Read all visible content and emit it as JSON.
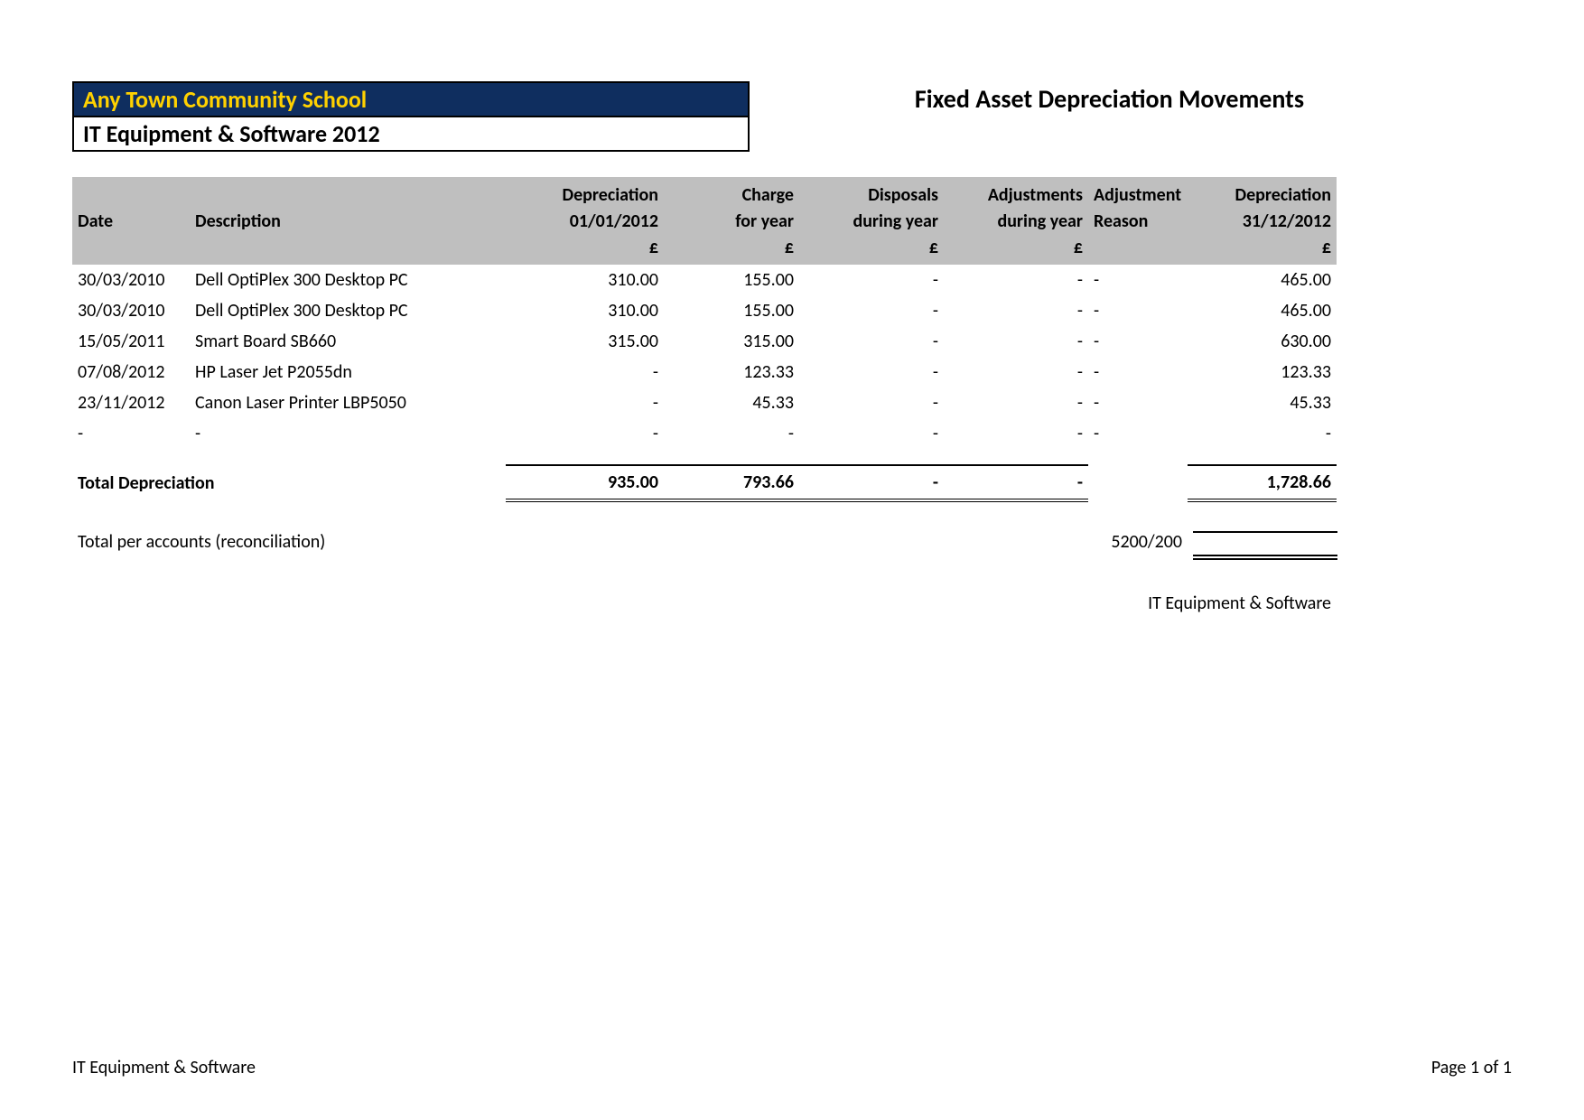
{
  "header": {
    "school_name": "Any Town Community School",
    "category_title": "IT Equipment & Software 2012",
    "report_title": "Fixed Asset Depreciation Movements"
  },
  "columns": {
    "date": "Date",
    "description": "Description",
    "open_l1": "Depreciation",
    "open_l2": "01/01/2012",
    "charge_l1": "Charge",
    "charge_l2": "for year",
    "disposals_l1": "Disposals",
    "disposals_l2": "during year",
    "adjustments_l1": "Adjustments",
    "adjustments_l2": "during year",
    "reason_l1": "Adjustment",
    "reason_l2": "Reason",
    "close_l1": "Depreciation",
    "close_l2": "31/12/2012",
    "currency": "£"
  },
  "rows": [
    {
      "date": "30/03/2010",
      "description": "Dell OptiPlex 300 Desktop PC",
      "open": "310.00",
      "charge": "155.00",
      "disposals": "-",
      "adjustments": "-",
      "reason": "-",
      "close": "465.00"
    },
    {
      "date": "30/03/2010",
      "description": "Dell OptiPlex 300 Desktop PC",
      "open": "310.00",
      "charge": "155.00",
      "disposals": "-",
      "adjustments": "-",
      "reason": "-",
      "close": "465.00"
    },
    {
      "date": "15/05/2011",
      "description": "Smart Board SB660",
      "open": "315.00",
      "charge": "315.00",
      "disposals": "-",
      "adjustments": "-",
      "reason": "-",
      "close": "630.00"
    },
    {
      "date": "07/08/2012",
      "description": "HP Laser Jet P2055dn",
      "open": "-",
      "charge": "123.33",
      "disposals": "-",
      "adjustments": "-",
      "reason": "-",
      "close": "123.33"
    },
    {
      "date": "23/11/2012",
      "description": "Canon Laser Printer LBP5050",
      "open": "-",
      "charge": "45.33",
      "disposals": "-",
      "adjustments": "-",
      "reason": "-",
      "close": "45.33"
    },
    {
      "date": "-",
      "description": "-",
      "open": "-",
      "charge": "-",
      "disposals": "-",
      "adjustments": "-",
      "reason": "-",
      "close": "-"
    }
  ],
  "totals": {
    "label": "Total Depreciation",
    "open": "935.00",
    "charge": "793.66",
    "disposals": "-",
    "adjustments": "-",
    "close": "1,728.66"
  },
  "reconciliation": {
    "label": "Total per accounts (reconciliation)",
    "account_code": "5200/200"
  },
  "footer": {
    "category_label": "IT Equipment & Software",
    "left": "IT Equipment & Software",
    "right": "Page 1 of 1"
  }
}
